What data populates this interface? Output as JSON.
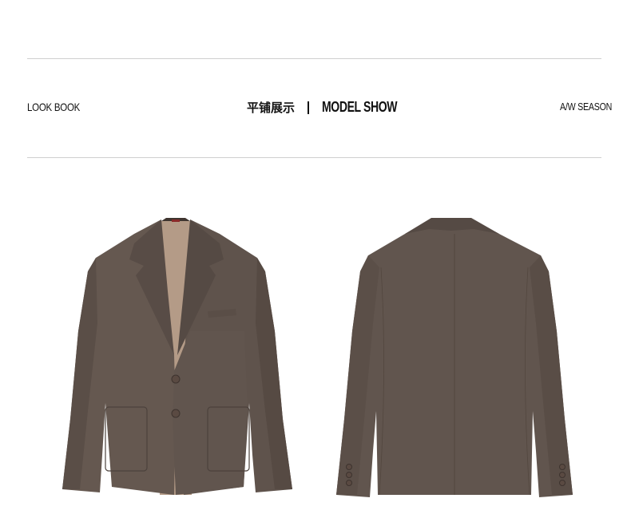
{
  "header": {
    "left_label": "LOOK BOOK",
    "center_cn": "平铺展示",
    "center_en": "MODEL SHOW",
    "right_label": "A/W SEASON"
  },
  "colors": {
    "jacket": "#64574f",
    "jacket_shadow": "#4e433d",
    "lining": "#b49b87",
    "button": "#5a4a42"
  },
  "products": [
    {
      "view": "jacket-front"
    },
    {
      "view": "jacket-back"
    }
  ]
}
